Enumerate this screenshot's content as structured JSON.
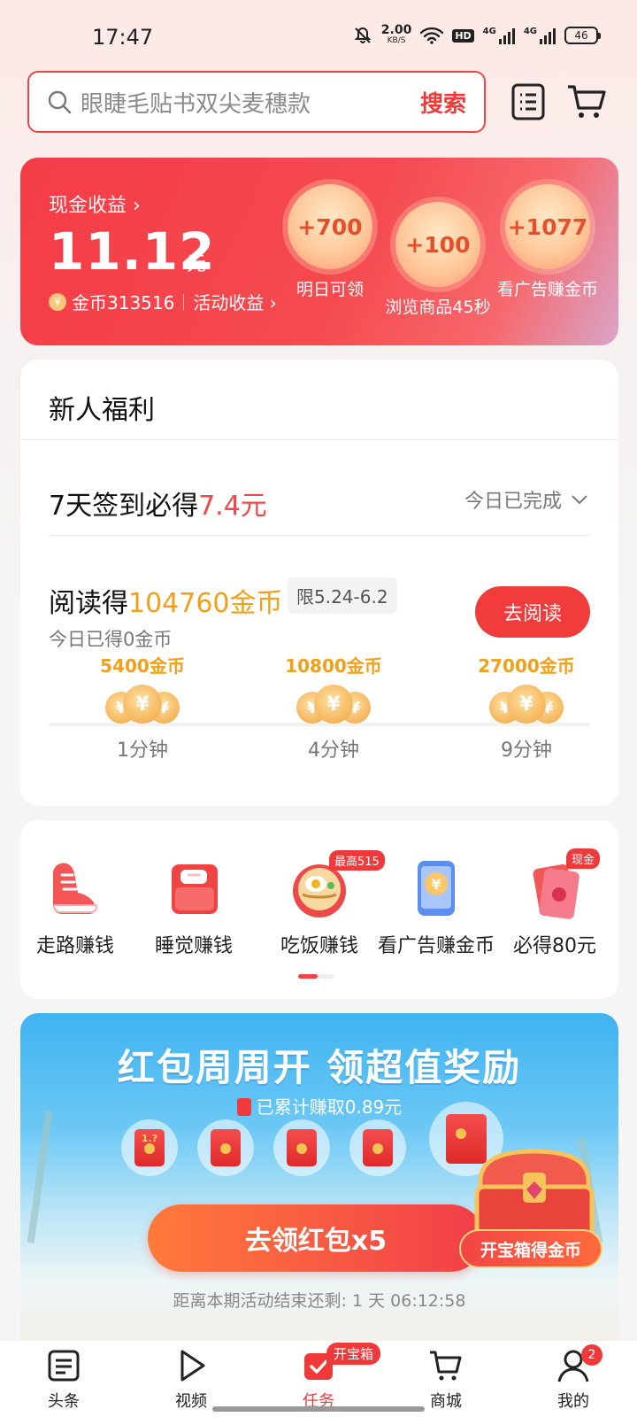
{
  "status_bar": {
    "time": "17:47",
    "net_speed": "2.00",
    "net_unit": "KB/S",
    "hd": "HD",
    "signal_1": "4G",
    "signal_2": "4G",
    "battery": "46"
  },
  "search": {
    "placeholder": "眼睫毛贴书双尖麦穗款",
    "button": "搜索"
  },
  "cash_card": {
    "label": "现金收益 ›",
    "amount": "11.12",
    "unit": "元",
    "coin_icon": "¥",
    "coins": "金币313516",
    "activity": "活动收益 ›",
    "rewards": [
      {
        "value": "+700",
        "label": "明日可领"
      },
      {
        "value": "+100",
        "label": "浏览商品45秒"
      },
      {
        "value": "+1077",
        "label": "看广告赚金币"
      }
    ]
  },
  "newcomer": {
    "title": "新人福利",
    "signin_prefix": "7天签到必得",
    "signin_amount": "7.4元",
    "signin_status": "今日已完成",
    "read_prefix": "阅读得",
    "read_amount": "104760金币",
    "limit": "限5.24-6.2",
    "read_today": "今日已得0金币",
    "read_button": "去阅读",
    "milestones": [
      {
        "coins": "5400金币",
        "time": "1分钟"
      },
      {
        "coins": "10800金币",
        "time": "4分钟"
      },
      {
        "coins": "27000金币",
        "time": "9分钟"
      }
    ]
  },
  "tasks": [
    {
      "label": "走路赚钱",
      "icon": "shoe-icon",
      "badge": ""
    },
    {
      "label": "睡觉赚钱",
      "icon": "bed-icon",
      "badge": ""
    },
    {
      "label": "吃饭赚钱",
      "icon": "food-bowl-icon",
      "badge": "最高515"
    },
    {
      "label": "看广告赚金币",
      "icon": "phone-coin-icon",
      "badge": ""
    },
    {
      "label": "必得80元",
      "icon": "red-envelope-icon",
      "badge": "现金"
    }
  ],
  "red_packet": {
    "title": "红包周周开 领超值奖励",
    "earned": "已累计赚取0.89元",
    "first_envelope": "1.?",
    "claim_button": "去领红包x5",
    "chest_button": "开宝箱得金币",
    "countdown_label": "距离本期活动结束还剩: ",
    "countdown_value": "1 天 06:12:58"
  },
  "bottom_nav": [
    {
      "label": "头条",
      "icon": "news-icon"
    },
    {
      "label": "视频",
      "icon": "play-icon"
    },
    {
      "label": "任务",
      "icon": "task-check-icon",
      "badge": "开宝箱"
    },
    {
      "label": "商城",
      "icon": "cart-icon"
    },
    {
      "label": "我的",
      "icon": "user-icon",
      "badge": "2"
    }
  ],
  "colors": {
    "accent_red": "#f03a3a",
    "coin_orange": "#f2a019",
    "card_red": "#f54a50"
  }
}
